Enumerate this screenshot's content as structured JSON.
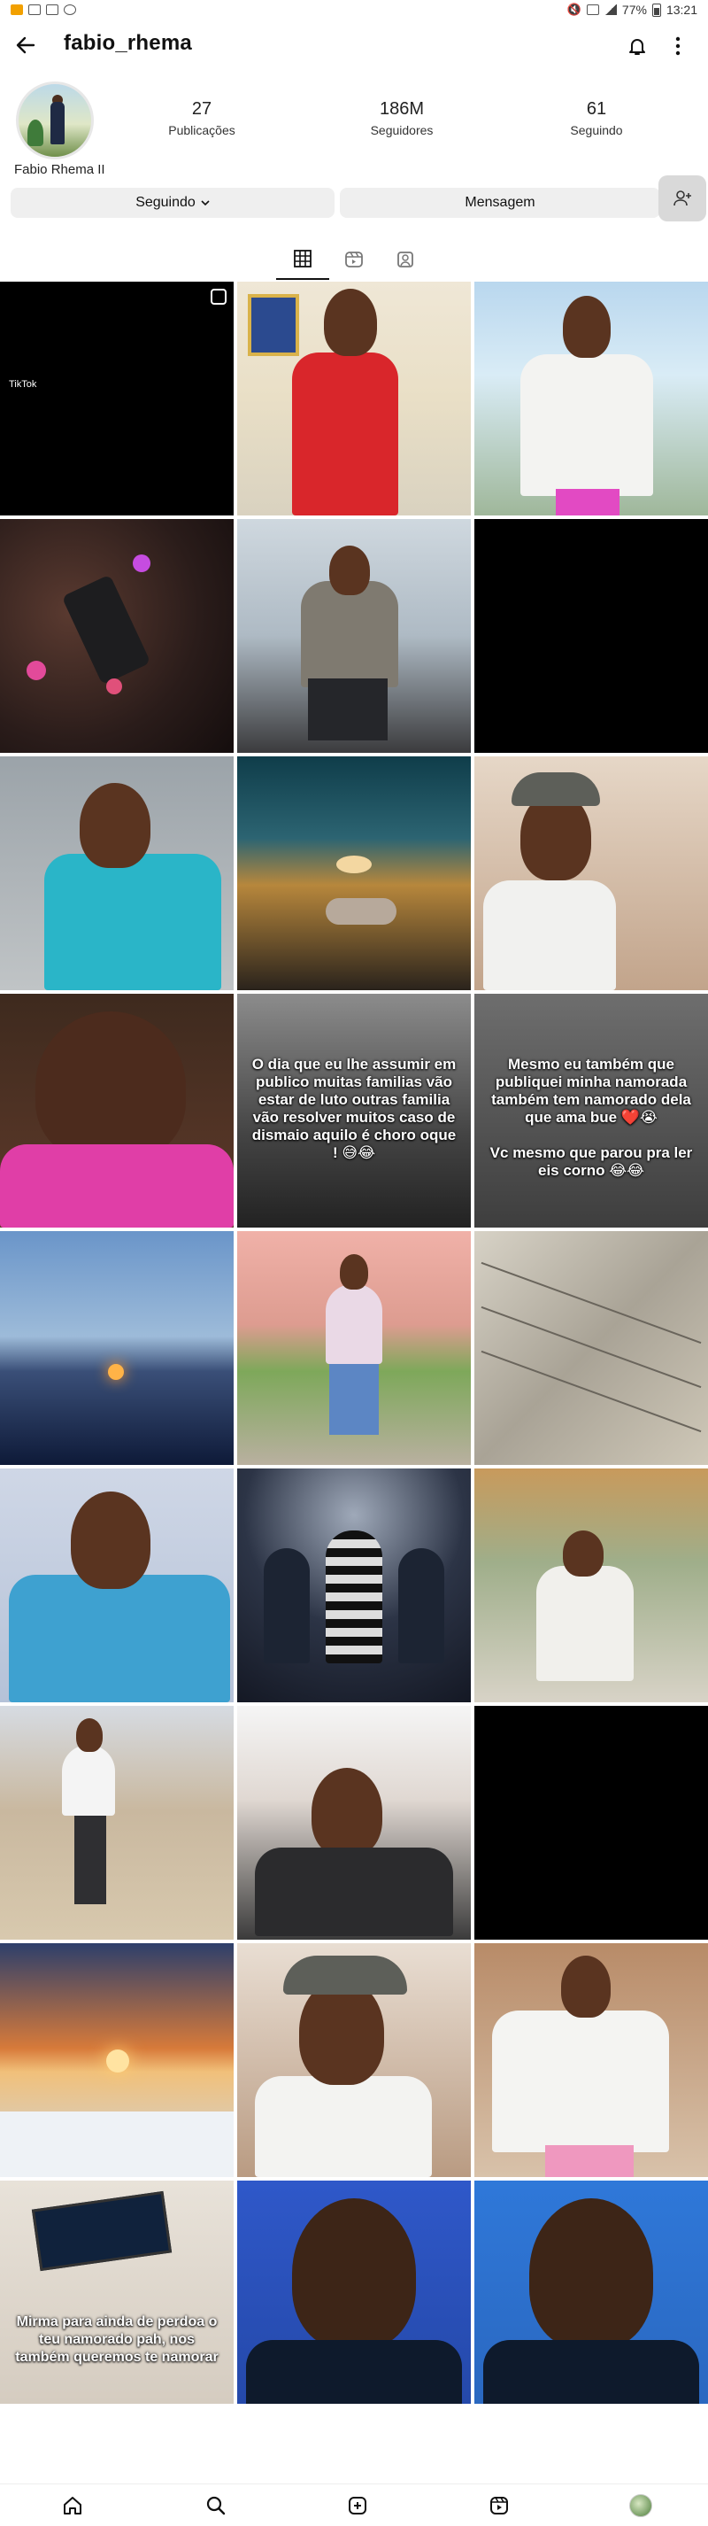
{
  "status_bar": {
    "left_icons": [
      "notification-icon",
      "gallery-icon",
      "mail-icon",
      "whatsapp-icon"
    ],
    "right_icons": [
      "mute-icon",
      "no-sim-icon",
      "signal-icon",
      "battery-icon"
    ],
    "battery": "77%",
    "time": "13:21"
  },
  "header": {
    "username": "fabio_rhema",
    "back_icon": "arrow-left-icon",
    "bell_icon": "bell-icon",
    "more_icon": "more-vertical-icon"
  },
  "profile": {
    "display_name": "Fabio Rhema II",
    "stats": {
      "posts_count": "27",
      "posts_label": "Publicações",
      "followers_count": "186M",
      "followers_label": "Seguidores",
      "following_count": "61",
      "following_label": "Seguindo"
    }
  },
  "actions": {
    "following_label": "Seguindo",
    "message_label": "Mensagem",
    "suggest_icon": "add-person-icon"
  },
  "tabs": [
    "grid-icon",
    "reels-icon",
    "tagged-icon"
  ],
  "posts": [
    {
      "caption": "",
      "overlay": "TikTok"
    },
    {
      "caption": ""
    },
    {
      "caption": ""
    },
    {
      "caption": ""
    },
    {
      "caption": ""
    },
    {
      "caption": ""
    },
    {
      "caption": ""
    },
    {
      "caption": ""
    },
    {
      "caption": ""
    },
    {
      "caption": ""
    },
    {
      "caption": "O dia que eu lhe assumir em publico muitas familias vão estar de luto outras familia vão resolver muitos caso de dismaio aquilo é choro oque ! 😅😂"
    },
    {
      "caption": "Mesmo eu também que publiquei minha namorada também tem namorado dela que ama bue ❤️😭\n\nVc mesmo que parou pra ler eis corno 😂😂"
    },
    {
      "caption": ""
    },
    {
      "caption": ""
    },
    {
      "caption": ""
    },
    {
      "caption": ""
    },
    {
      "caption": ""
    },
    {
      "caption": ""
    },
    {
      "caption": ""
    },
    {
      "caption": ""
    },
    {
      "caption": ""
    },
    {
      "caption": ""
    },
    {
      "caption": ""
    },
    {
      "caption": ""
    },
    {
      "caption": "Mirma para ainda de perdoa o teu namorado pah, nos também queremos te namorar"
    },
    {
      "caption": ""
    },
    {
      "caption": ""
    }
  ],
  "bottom_nav": [
    "home-icon",
    "search-icon",
    "create-icon",
    "reels-nav-icon",
    "profile-avatar"
  ]
}
